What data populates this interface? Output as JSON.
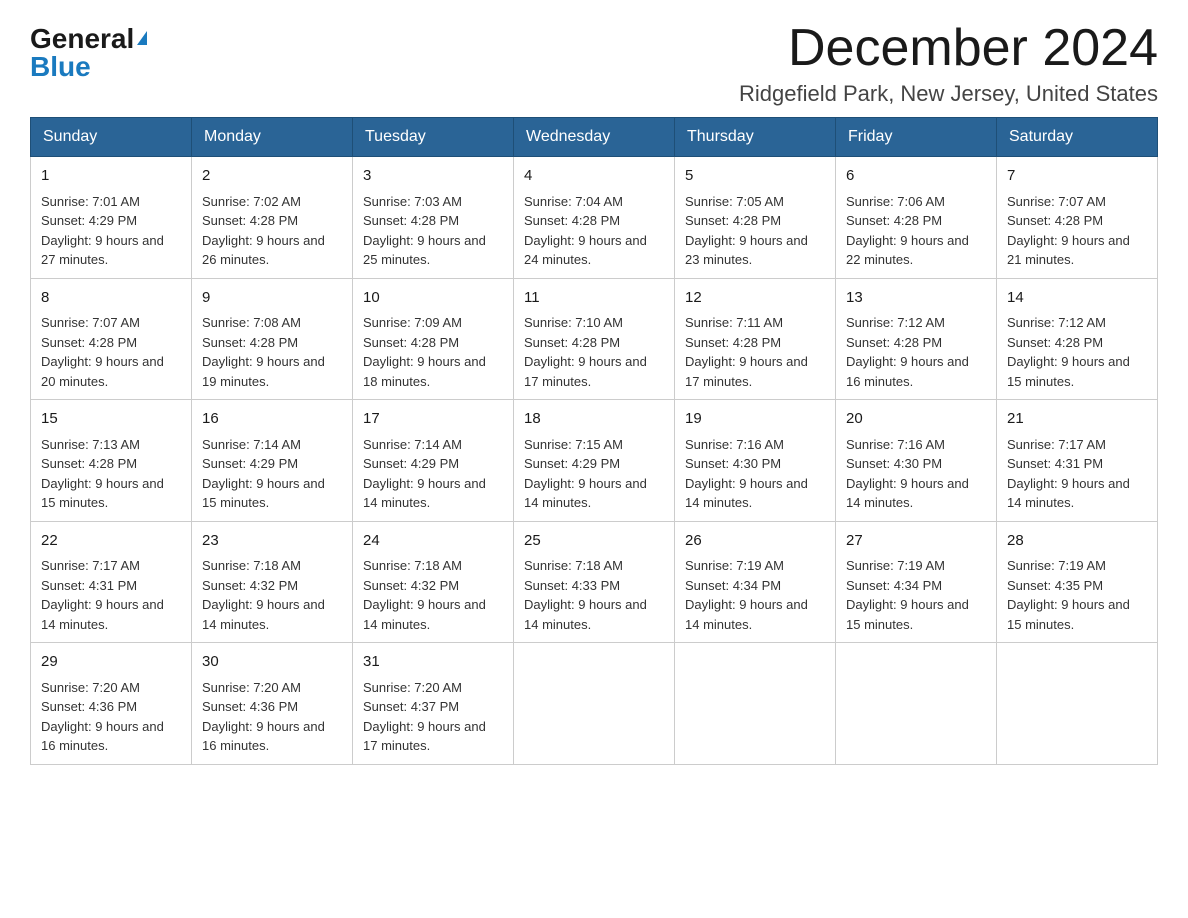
{
  "logo": {
    "general": "General",
    "blue": "Blue"
  },
  "title": {
    "month": "December 2024",
    "location": "Ridgefield Park, New Jersey, United States"
  },
  "weekdays": [
    "Sunday",
    "Monday",
    "Tuesday",
    "Wednesday",
    "Thursday",
    "Friday",
    "Saturday"
  ],
  "weeks": [
    [
      {
        "day": "1",
        "sunrise": "Sunrise: 7:01 AM",
        "sunset": "Sunset: 4:29 PM",
        "daylight": "Daylight: 9 hours and 27 minutes."
      },
      {
        "day": "2",
        "sunrise": "Sunrise: 7:02 AM",
        "sunset": "Sunset: 4:28 PM",
        "daylight": "Daylight: 9 hours and 26 minutes."
      },
      {
        "day": "3",
        "sunrise": "Sunrise: 7:03 AM",
        "sunset": "Sunset: 4:28 PM",
        "daylight": "Daylight: 9 hours and 25 minutes."
      },
      {
        "day": "4",
        "sunrise": "Sunrise: 7:04 AM",
        "sunset": "Sunset: 4:28 PM",
        "daylight": "Daylight: 9 hours and 24 minutes."
      },
      {
        "day": "5",
        "sunrise": "Sunrise: 7:05 AM",
        "sunset": "Sunset: 4:28 PM",
        "daylight": "Daylight: 9 hours and 23 minutes."
      },
      {
        "day": "6",
        "sunrise": "Sunrise: 7:06 AM",
        "sunset": "Sunset: 4:28 PM",
        "daylight": "Daylight: 9 hours and 22 minutes."
      },
      {
        "day": "7",
        "sunrise": "Sunrise: 7:07 AM",
        "sunset": "Sunset: 4:28 PM",
        "daylight": "Daylight: 9 hours and 21 minutes."
      }
    ],
    [
      {
        "day": "8",
        "sunrise": "Sunrise: 7:07 AM",
        "sunset": "Sunset: 4:28 PM",
        "daylight": "Daylight: 9 hours and 20 minutes."
      },
      {
        "day": "9",
        "sunrise": "Sunrise: 7:08 AM",
        "sunset": "Sunset: 4:28 PM",
        "daylight": "Daylight: 9 hours and 19 minutes."
      },
      {
        "day": "10",
        "sunrise": "Sunrise: 7:09 AM",
        "sunset": "Sunset: 4:28 PM",
        "daylight": "Daylight: 9 hours and 18 minutes."
      },
      {
        "day": "11",
        "sunrise": "Sunrise: 7:10 AM",
        "sunset": "Sunset: 4:28 PM",
        "daylight": "Daylight: 9 hours and 17 minutes."
      },
      {
        "day": "12",
        "sunrise": "Sunrise: 7:11 AM",
        "sunset": "Sunset: 4:28 PM",
        "daylight": "Daylight: 9 hours and 17 minutes."
      },
      {
        "day": "13",
        "sunrise": "Sunrise: 7:12 AM",
        "sunset": "Sunset: 4:28 PM",
        "daylight": "Daylight: 9 hours and 16 minutes."
      },
      {
        "day": "14",
        "sunrise": "Sunrise: 7:12 AM",
        "sunset": "Sunset: 4:28 PM",
        "daylight": "Daylight: 9 hours and 15 minutes."
      }
    ],
    [
      {
        "day": "15",
        "sunrise": "Sunrise: 7:13 AM",
        "sunset": "Sunset: 4:28 PM",
        "daylight": "Daylight: 9 hours and 15 minutes."
      },
      {
        "day": "16",
        "sunrise": "Sunrise: 7:14 AM",
        "sunset": "Sunset: 4:29 PM",
        "daylight": "Daylight: 9 hours and 15 minutes."
      },
      {
        "day": "17",
        "sunrise": "Sunrise: 7:14 AM",
        "sunset": "Sunset: 4:29 PM",
        "daylight": "Daylight: 9 hours and 14 minutes."
      },
      {
        "day": "18",
        "sunrise": "Sunrise: 7:15 AM",
        "sunset": "Sunset: 4:29 PM",
        "daylight": "Daylight: 9 hours and 14 minutes."
      },
      {
        "day": "19",
        "sunrise": "Sunrise: 7:16 AM",
        "sunset": "Sunset: 4:30 PM",
        "daylight": "Daylight: 9 hours and 14 minutes."
      },
      {
        "day": "20",
        "sunrise": "Sunrise: 7:16 AM",
        "sunset": "Sunset: 4:30 PM",
        "daylight": "Daylight: 9 hours and 14 minutes."
      },
      {
        "day": "21",
        "sunrise": "Sunrise: 7:17 AM",
        "sunset": "Sunset: 4:31 PM",
        "daylight": "Daylight: 9 hours and 14 minutes."
      }
    ],
    [
      {
        "day": "22",
        "sunrise": "Sunrise: 7:17 AM",
        "sunset": "Sunset: 4:31 PM",
        "daylight": "Daylight: 9 hours and 14 minutes."
      },
      {
        "day": "23",
        "sunrise": "Sunrise: 7:18 AM",
        "sunset": "Sunset: 4:32 PM",
        "daylight": "Daylight: 9 hours and 14 minutes."
      },
      {
        "day": "24",
        "sunrise": "Sunrise: 7:18 AM",
        "sunset": "Sunset: 4:32 PM",
        "daylight": "Daylight: 9 hours and 14 minutes."
      },
      {
        "day": "25",
        "sunrise": "Sunrise: 7:18 AM",
        "sunset": "Sunset: 4:33 PM",
        "daylight": "Daylight: 9 hours and 14 minutes."
      },
      {
        "day": "26",
        "sunrise": "Sunrise: 7:19 AM",
        "sunset": "Sunset: 4:34 PM",
        "daylight": "Daylight: 9 hours and 14 minutes."
      },
      {
        "day": "27",
        "sunrise": "Sunrise: 7:19 AM",
        "sunset": "Sunset: 4:34 PM",
        "daylight": "Daylight: 9 hours and 15 minutes."
      },
      {
        "day": "28",
        "sunrise": "Sunrise: 7:19 AM",
        "sunset": "Sunset: 4:35 PM",
        "daylight": "Daylight: 9 hours and 15 minutes."
      }
    ],
    [
      {
        "day": "29",
        "sunrise": "Sunrise: 7:20 AM",
        "sunset": "Sunset: 4:36 PM",
        "daylight": "Daylight: 9 hours and 16 minutes."
      },
      {
        "day": "30",
        "sunrise": "Sunrise: 7:20 AM",
        "sunset": "Sunset: 4:36 PM",
        "daylight": "Daylight: 9 hours and 16 minutes."
      },
      {
        "day": "31",
        "sunrise": "Sunrise: 7:20 AM",
        "sunset": "Sunset: 4:37 PM",
        "daylight": "Daylight: 9 hours and 17 minutes."
      },
      null,
      null,
      null,
      null
    ]
  ]
}
